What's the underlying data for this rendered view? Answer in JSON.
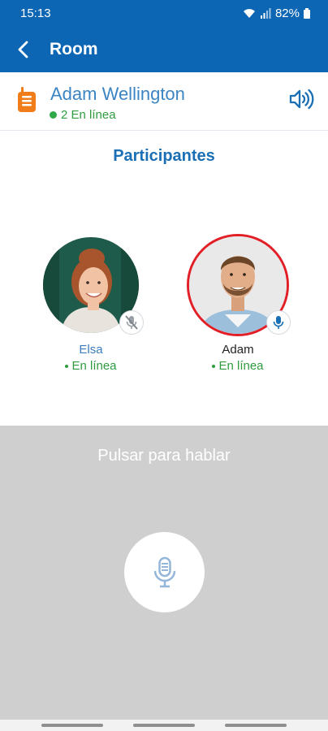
{
  "status_bar": {
    "time": "15:13",
    "battery": "82%"
  },
  "app_bar": {
    "title": "Room"
  },
  "channel": {
    "name": "Adam Wellington",
    "online": "2 En línea"
  },
  "participants_title": "Participantes",
  "participants": [
    {
      "name": "Elsa",
      "status": "En línea",
      "speaking": false,
      "mic": "muted"
    },
    {
      "name": "Adam",
      "status": "En línea",
      "speaking": true,
      "mic": "active"
    }
  ],
  "ptt": {
    "label": "Pulsar para hablar"
  },
  "colors": {
    "primary": "#0d66b3",
    "online": "#2e9c3f",
    "speaking_ring": "#e21f26",
    "ptt_panel": "#cfcfcf",
    "radio_icon": "#f07d19"
  }
}
